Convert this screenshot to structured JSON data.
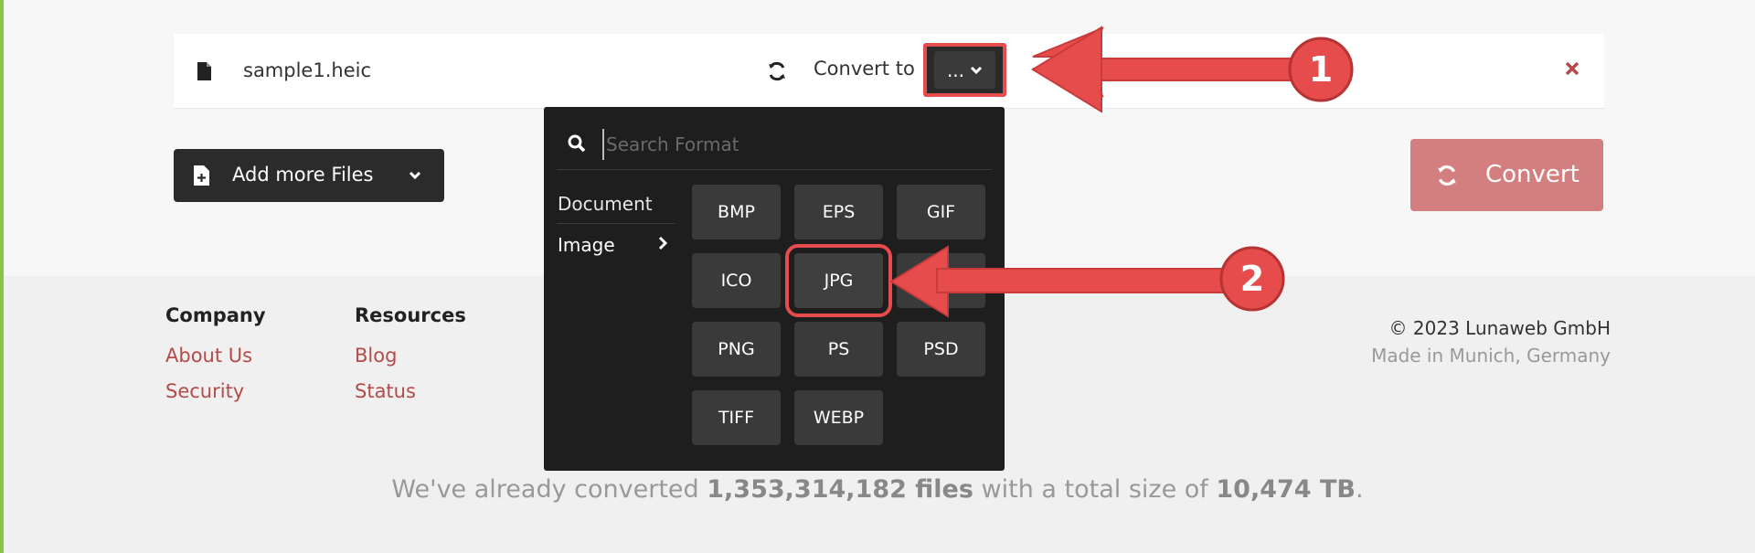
{
  "file": {
    "name": "sample1.heic",
    "convert_to_label": "Convert to",
    "format_button_label": "..."
  },
  "actions": {
    "add_more_files_label": "Add more Files",
    "convert_label": "Convert"
  },
  "format_dropdown": {
    "search_placeholder": "Search Format",
    "categories": [
      {
        "label": "Document",
        "active": false
      },
      {
        "label": "Image",
        "active": true
      }
    ],
    "formats": [
      "BMP",
      "EPS",
      "GIF",
      "ICO",
      "JPG",
      "PNG",
      "PS",
      "PSD",
      "TIFF",
      "WEBP"
    ],
    "highlighted_format": "JPG"
  },
  "footer": {
    "company": {
      "title": "Company",
      "links": [
        "About Us",
        "Security"
      ]
    },
    "resources": {
      "title": "Resources",
      "links": [
        "Blog",
        "Status"
      ]
    },
    "copyright": "© 2023 Lunaweb GmbH",
    "made_in": "Made in Munich, Germany",
    "stats": {
      "prefix": "We've already converted ",
      "files": "1,353,314,182 files",
      "middle": " with a total size of ",
      "size": "10,474 TB",
      "suffix": "."
    }
  },
  "annotations": {
    "step1": "1",
    "step2": "2"
  },
  "colors": {
    "accent_red": "#e74c4c",
    "link_red": "#b54a4a",
    "convert_button": "#d47f7f",
    "dark_button": "#2b2b2b",
    "left_accent": "#8bc34a"
  },
  "icons": [
    "file-icon",
    "sync-icon",
    "chevron-down-icon",
    "close-icon",
    "add-file-icon",
    "search-icon",
    "chevron-right-icon"
  ]
}
